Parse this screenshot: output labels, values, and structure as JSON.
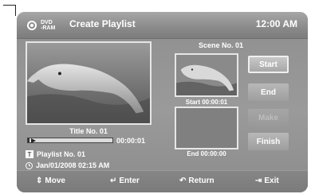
{
  "header": {
    "disc_line1": "DVD",
    "disc_line2": "-RAM",
    "title": "Create Playlist",
    "clock": "12:00 AM"
  },
  "main_preview": {
    "title_label": "Title No. 01",
    "elapsed": "00:00:01",
    "progress_fraction": 0.02,
    "playlist_label": "Playlist No. 01",
    "date_label": "Jan/01/2008  02:15 AM"
  },
  "scene": {
    "heading": "Scene No. 01",
    "start_label": "Start 00:00:01",
    "end_label": "End 00:00:00"
  },
  "buttons": {
    "start": "Start",
    "end": "End",
    "make": "Make",
    "finish": "Finish"
  },
  "footer": {
    "move": "Move",
    "enter": "Enter",
    "return": "Return",
    "exit": "Exit"
  },
  "icons": {
    "disc": "dvd-ram-disc-icon",
    "play": "play-icon",
    "title_tag": "T",
    "date": "clock-icon",
    "move": "up-down-arrows-icon",
    "enter": "enter-icon",
    "return": "return-arrow-icon",
    "exit": "exit-door-icon"
  }
}
